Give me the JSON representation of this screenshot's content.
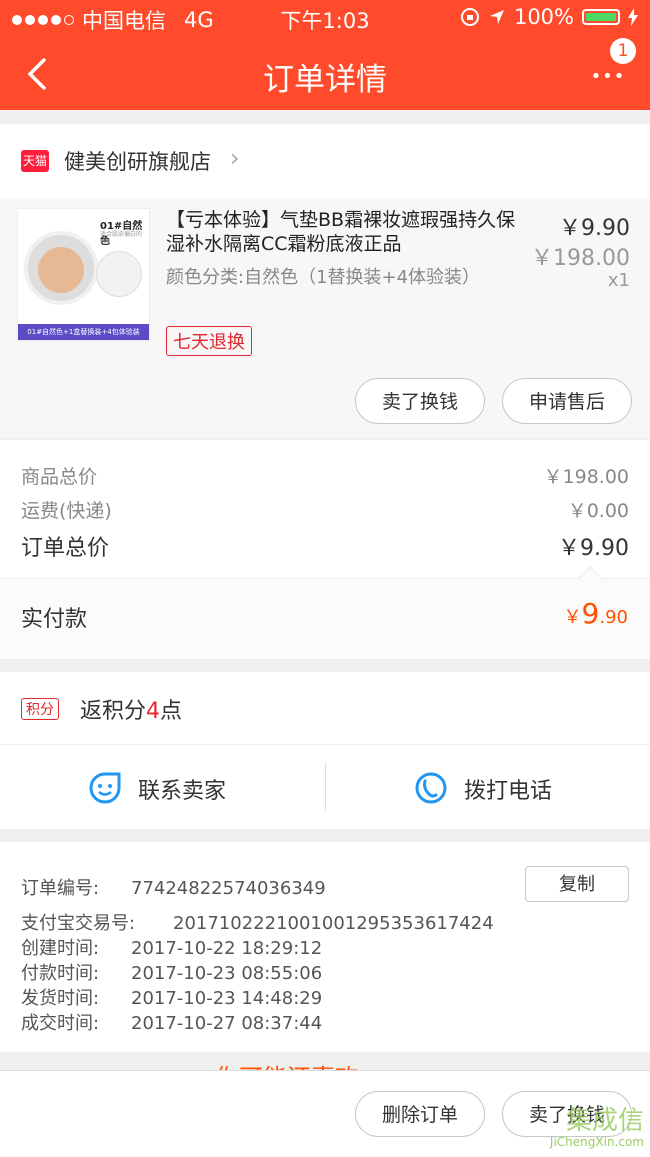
{
  "statusbar": {
    "carrier": "中国电信",
    "network": "4G",
    "time": "下午1:03",
    "battery": "100%"
  },
  "navbar": {
    "title": "订单详情",
    "badge": "1",
    "more": "•••"
  },
  "shop": {
    "tag": "天猫",
    "name": "健美创研旗舰店"
  },
  "item": {
    "thumb_label": "01#自然色",
    "thumb_sub": "适合肌肤偏白的MM",
    "thumb_bar": "01#自然色+1盒替换装+4包体验装",
    "title": "【亏本体验】气垫BB霜裸妆遮瑕强持久保湿补水隔离CC霜粉底液正品",
    "spec": "颜色分类:自然色（1替换装+4体验装）",
    "tag": "七天退换",
    "price": "￥9.90",
    "original_price": "￥198.00",
    "quantity": "x1",
    "btn_sell": "卖了换钱",
    "btn_aftersale": "申请售后"
  },
  "summary": {
    "goods_label": "商品总价",
    "goods_value": "￥198.00",
    "shipping_label": "运费(快递)",
    "shipping_value": "￥0.00",
    "total_label": "订单总价",
    "total_value": "￥9.90",
    "paid_label": "实付款",
    "paid_currency": "￥",
    "paid_int": "9",
    "paid_dec": ".90"
  },
  "points": {
    "tag": "积分",
    "prefix": "返积分",
    "number": "4",
    "suffix": "点"
  },
  "contact": {
    "seller": "联系卖家",
    "call": "拨打电话"
  },
  "order_info": {
    "copy": "复制",
    "rows": [
      {
        "label": "订单编号:",
        "value": "77424822574036349"
      },
      {
        "label": "支付宝交易号:",
        "value": "2017102221001001295353617424"
      },
      {
        "label": "创建时间:",
        "value": "2017-10-22 18:29:12"
      },
      {
        "label": "付款时间:",
        "value": "2017-10-23 08:55:06"
      },
      {
        "label": "发货时间:",
        "value": "2017-10-23 14:48:29"
      },
      {
        "label": "成交时间:",
        "value": "2017-10-27 08:37:44"
      }
    ]
  },
  "teaser": "你可能还喜欢",
  "bottom": {
    "delete": "删除订单",
    "sell": "卖了换钱"
  },
  "watermark": {
    "main": "集成信",
    "url": "JiChengXin.com"
  },
  "colors": {
    "brand": "#ff4b2b",
    "price_accent": "#ff5000",
    "tag_red": "#e4262e"
  }
}
